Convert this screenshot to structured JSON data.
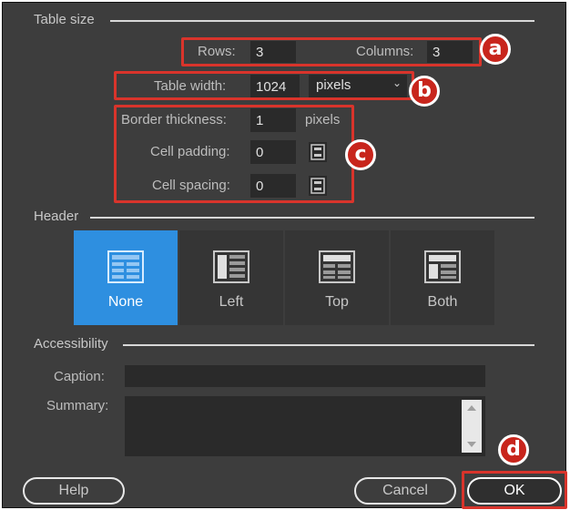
{
  "table_size": {
    "title": "Table size",
    "rows_label": "Rows:",
    "rows_value": "3",
    "columns_label": "Columns:",
    "columns_value": "3",
    "width_label": "Table width:",
    "width_value": "1024",
    "width_unit": "pixels",
    "border_label": "Border thickness:",
    "border_value": "1",
    "border_unit": "pixels",
    "padding_label": "Cell padding:",
    "padding_value": "0",
    "spacing_label": "Cell spacing:",
    "spacing_value": "0"
  },
  "header": {
    "title": "Header",
    "options": [
      {
        "label": "None",
        "icon": "table-none-icon",
        "selected": true
      },
      {
        "label": "Left",
        "icon": "table-left-header-icon",
        "selected": false
      },
      {
        "label": "Top",
        "icon": "table-top-header-icon",
        "selected": false
      },
      {
        "label": "Both",
        "icon": "table-both-header-icon",
        "selected": false
      }
    ]
  },
  "accessibility": {
    "title": "Accessibility",
    "caption_label": "Caption:",
    "caption_value": "",
    "summary_label": "Summary:",
    "summary_value": ""
  },
  "buttons": {
    "help": "Help",
    "cancel": "Cancel",
    "ok": "OK"
  },
  "callouts": {
    "a": "a",
    "b": "b",
    "c": "c",
    "d": "d"
  },
  "colors": {
    "dialog_bg": "#3d3d3d",
    "field_bg": "#2a2a2a",
    "selected_blue": "#2e8fe0",
    "callout_red": "#c8251c",
    "highlight_red": "#d9342b"
  }
}
